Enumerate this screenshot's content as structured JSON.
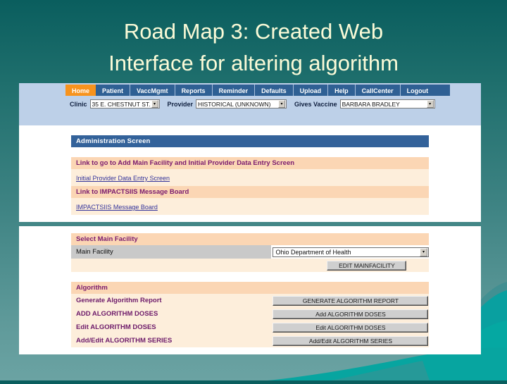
{
  "slide": {
    "title": "Road Map 3: Created Web\nInterface for altering algorithm",
    "title_color": "#fbfbd8",
    "background_top": "#0a5e5e",
    "background_bottom": "#6ba3a3"
  },
  "app": {
    "nav_tabs": [
      {
        "label": "Home",
        "active": true
      },
      {
        "label": "Patient",
        "active": false
      },
      {
        "label": "VaccMgmt",
        "active": false
      },
      {
        "label": "Reports",
        "active": false
      },
      {
        "label": "Reminder",
        "active": false
      },
      {
        "label": "Defaults",
        "active": false
      },
      {
        "label": "Upload",
        "active": false
      },
      {
        "label": "Help",
        "active": false
      },
      {
        "label": "CallCenter",
        "active": false
      },
      {
        "label": "Logout",
        "active": false
      }
    ],
    "nav_active_color": "#f7931d",
    "nav_bar_color": "#2f6094",
    "header_band_color": "#bdd0e8",
    "selectors": [
      {
        "label": "Clinic",
        "value": "35 E. CHESTNUT ST."
      },
      {
        "label": "Provider",
        "value": "HISTORICAL (UNKNOWN)"
      },
      {
        "label": "Gives Vaccine",
        "value": "BARBARA BRADLEY"
      }
    ]
  },
  "admin_panel": {
    "section_title": "Administration Screen",
    "rows": [
      {
        "type": "header",
        "label": "Link to go to Add Main Facility and Initial Provider Data Entry Screen"
      },
      {
        "type": "link",
        "label": "Initial Provider Data Entry Screen"
      },
      {
        "type": "header",
        "label": "Link to IMPACTSIIS Message Board"
      },
      {
        "type": "link",
        "label": "IMPACTSIIS Message Board"
      }
    ]
  },
  "facility_panel": {
    "section_title": "Select Main Facility",
    "field_label": "Main Facility",
    "field_value": "Ohio Department of Health",
    "edit_button": "EDIT MAINFACILITY"
  },
  "algorithm_panel": {
    "section_title": "Algorithm",
    "rows": [
      {
        "label": "Generate Algorithm Report",
        "button": "GENERATE ALGORITHM REPORT"
      },
      {
        "label": "ADD ALGORITHM DOSES",
        "button": "Add ALGORITHM DOSES"
      },
      {
        "label": "Edit ALGORITHM DOSES",
        "button": "Edit ALGORITHM DOSES"
      },
      {
        "label": "Add/Edit ALGORITHM SERIES",
        "button": "Add/Edit ALGORITHM SERIES"
      }
    ]
  },
  "icons": {
    "dropdown_arrow": "▾"
  }
}
